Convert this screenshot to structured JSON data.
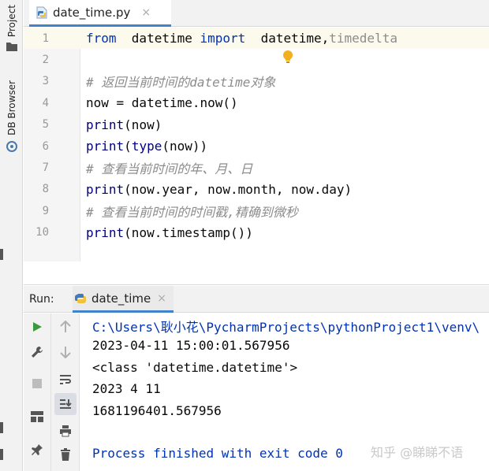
{
  "left_toolbar": {
    "project_label": "Project",
    "db_browser_label": "DB Browser"
  },
  "editor": {
    "tab": {
      "filename": "date_time.py",
      "close": "×"
    },
    "lines": [
      {
        "num": "1",
        "tokens": [
          {
            "t": "from",
            "c": "kw"
          },
          {
            "t": "  datetime ",
            "c": ""
          },
          {
            "t": "import",
            "c": "kw"
          },
          {
            "t": "  datetime,",
            "c": ""
          },
          {
            "t": "timedelta",
            "c": "unused"
          }
        ]
      },
      {
        "num": "2",
        "tokens": []
      },
      {
        "num": "3",
        "tokens": [
          {
            "t": "# 返回当前时间的datetime对象",
            "c": "cmt"
          }
        ]
      },
      {
        "num": "4",
        "tokens": [
          {
            "t": "now = datetime.now()",
            "c": ""
          }
        ]
      },
      {
        "num": "5",
        "tokens": [
          {
            "t": "print",
            "c": "builtin"
          },
          {
            "t": "(now)",
            "c": ""
          }
        ]
      },
      {
        "num": "6",
        "tokens": [
          {
            "t": "print",
            "c": "builtin"
          },
          {
            "t": "(",
            "c": ""
          },
          {
            "t": "type",
            "c": "builtin"
          },
          {
            "t": "(now))",
            "c": ""
          }
        ]
      },
      {
        "num": "7",
        "tokens": [
          {
            "t": "# 查看当前时间的年、月、日",
            "c": "cmt"
          }
        ]
      },
      {
        "num": "8",
        "tokens": [
          {
            "t": "print",
            "c": "builtin"
          },
          {
            "t": "(now.year, now.month, now.day)",
            "c": ""
          }
        ]
      },
      {
        "num": "9",
        "tokens": [
          {
            "t": "# 查看当前时间的时间戳,精确到微秒",
            "c": "cmt"
          }
        ]
      },
      {
        "num": "10",
        "tokens": [
          {
            "t": "print",
            "c": "builtin"
          },
          {
            "t": "(now.timestamp())",
            "c": ""
          }
        ]
      }
    ]
  },
  "run_panel": {
    "label": "Run:",
    "tab": {
      "name": "date_time",
      "close": "×"
    },
    "output": [
      {
        "text": "C:\\Users\\耿小花\\PycharmProjects\\pythonProject1\\venv\\",
        "kind": "path"
      },
      {
        "text": "2023-04-11 15:00:01.567956",
        "kind": ""
      },
      {
        "text": "<class 'datetime.datetime'>",
        "kind": ""
      },
      {
        "text": "2023 4 11",
        "kind": ""
      },
      {
        "text": "1681196401.567956",
        "kind": ""
      },
      {
        "text": "",
        "kind": ""
      },
      {
        "text": "Process finished with exit code 0",
        "kind": "proc"
      }
    ]
  },
  "watermark": "知乎 @睇睇不语",
  "colors": {
    "accent": "#4083c9",
    "keyword": "#0033b3",
    "comment": "#8c8c8c",
    "run_green": "#3c9a3c"
  }
}
